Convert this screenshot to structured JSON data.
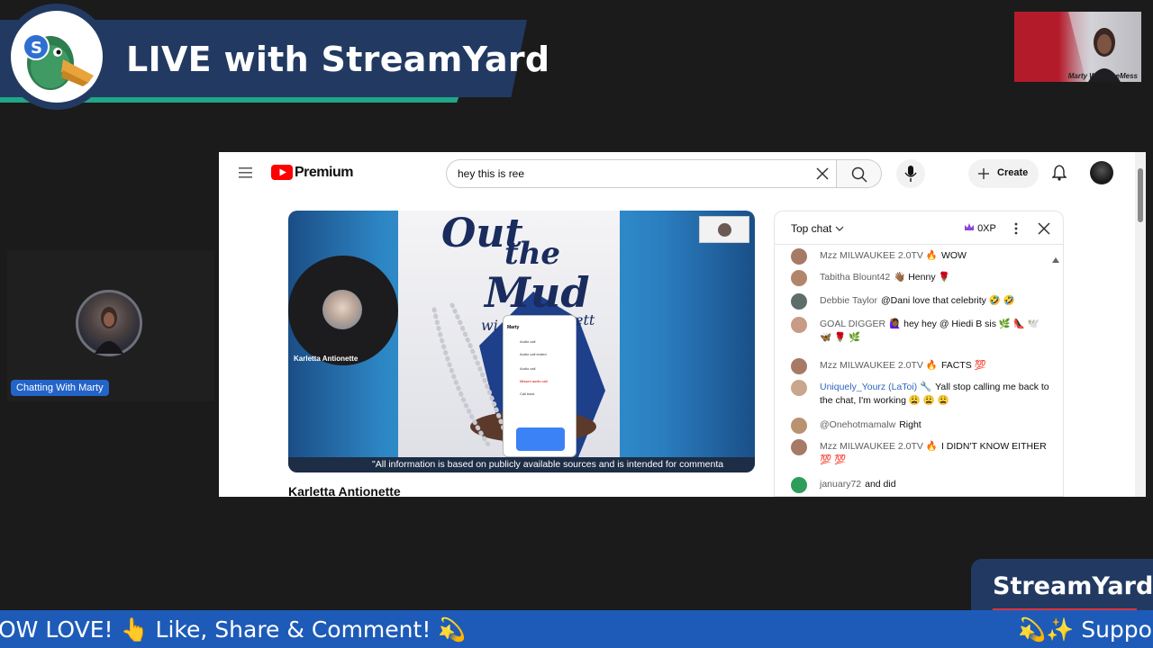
{
  "banner": {
    "title": "LIVE with StreamYard"
  },
  "thumb": {
    "caption": "Marty With TheMess"
  },
  "guest": {
    "name": "Chatting With Marty"
  },
  "youtube": {
    "brand": "Premium",
    "search_value": "hey this is ree",
    "create_label": "Create",
    "video": {
      "participant_name": "Karletta Antionette",
      "poster_title_line1": "Out",
      "poster_title_line2": "the",
      "poster_title_line3": "Mud",
      "poster_sub": "wi",
      "poster_sub2": "ett",
      "phone_name": "Marty",
      "phone_items": [
        "Audio call",
        "Audio call ended",
        "Audio call",
        "Missed audio call",
        "Call back"
      ],
      "caption": "\"All information is based on publicly available sources and is intended for commenta"
    },
    "channel_name": "Karletta Antionette",
    "chat": {
      "header": "Top chat",
      "xp": "0XP",
      "messages": [
        {
          "user": "Mzz MILWAUKEE 2.0TV 🔥",
          "text": "WOW"
        },
        {
          "user": "Tabitha Blount42",
          "text": "👋🏾 Henny 🌹"
        },
        {
          "user": "Debbie Taylor",
          "text": "@Dani love that celebrity 🤣 🤣"
        },
        {
          "user": "GOAL DIGGER",
          "text": "🙋🏾‍♀️ hey hey @ Hiedi B sis 🌿 👠 🕊️ 🦋 🌹 🌿"
        },
        {
          "user": "Mzz MILWAUKEE 2.0TV 🔥",
          "text": "FACTS 💯"
        },
        {
          "user": "Uniquely_Yourz (LaToi) 🔧",
          "text": "Yall stop calling me back to the chat, I'm working 😩 😩 😩"
        },
        {
          "user": "@Onehotmamalw",
          "text": "Right"
        },
        {
          "user": "Mzz MILWAUKEE 2.0TV 🔥",
          "text": "I DIDN'T KNOW EITHER 💯 💯"
        },
        {
          "user": "january72",
          "text": "and did"
        }
      ]
    }
  },
  "streamyard_tab": {
    "label": "StreamYard"
  },
  "ticker": {
    "left_text": "OW LOVE! 👆 Like, Share & Comment! 💫",
    "right_text": "💫✨ Suppo"
  },
  "colors": {
    "banner": "#223a62",
    "teal": "#21a686",
    "ticker": "#1e5bb8",
    "youtube_red": "#ff0000"
  }
}
